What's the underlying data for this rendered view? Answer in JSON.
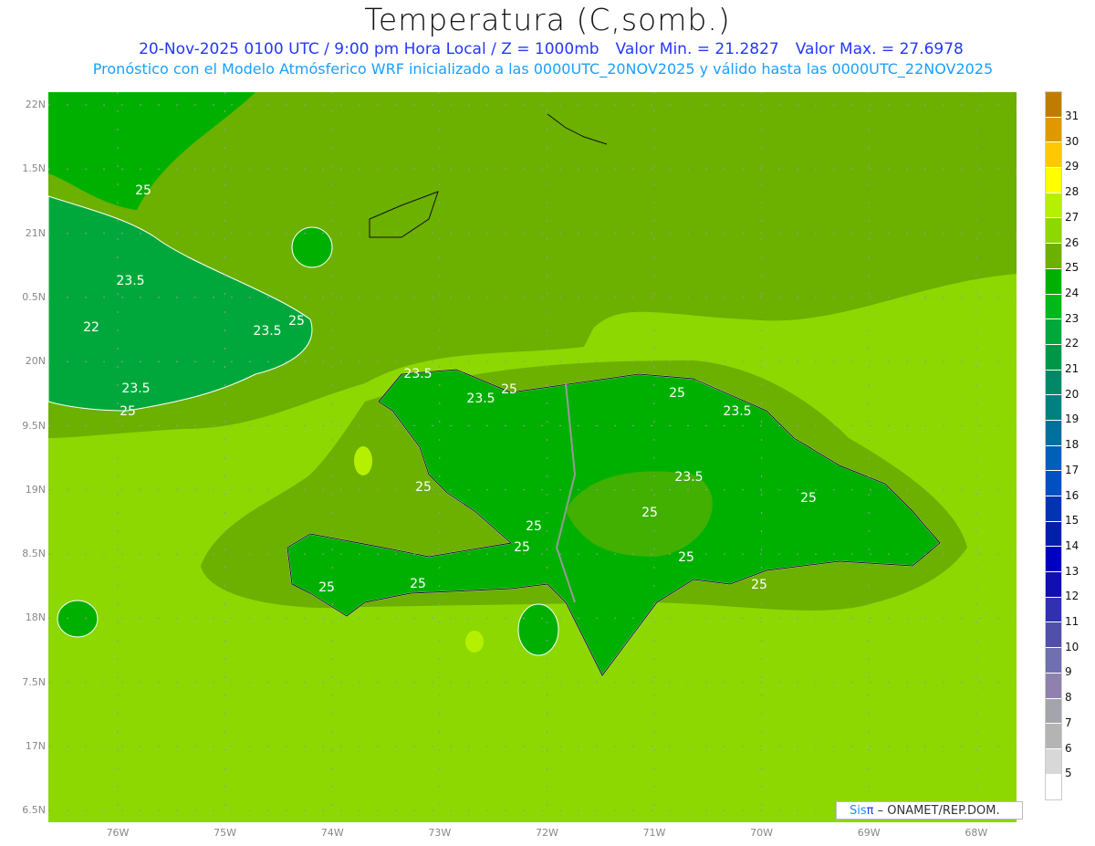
{
  "header": {
    "title": "Temperatura (C,somb.)",
    "date_line": "20-Nov-2025  0100 UTC / 9:00 pm Hora Local / Z = 1000mb",
    "min_label": "Valor Min. = 21.2827",
    "max_label": "Valor Max. = 27.6978",
    "model_line": "Pronóstico con el Modelo Atmósferico WRF inicializado a las 0000UTC_20NOV2025 y válido hasta las  0000UTC_22NOV2025"
  },
  "axes": {
    "lat_labels": [
      "22N",
      "1.5N",
      "21N",
      "0.5N",
      "20N",
      "9.5N",
      "19N",
      "8.5N",
      "18N",
      "7.5N",
      "17N",
      "6.5N"
    ],
    "lon_labels": [
      "76W",
      "75W",
      "74W",
      "73W",
      "72W",
      "71W",
      "70W",
      "69W",
      "68W"
    ]
  },
  "contour_labels": [
    "25",
    "23.5",
    "22",
    "23.5",
    "25",
    "23.5",
    "25",
    "23.5",
    "23.5",
    "25",
    "25",
    "23.5",
    "23.5",
    "25",
    "25",
    "25",
    "25",
    "25",
    "25",
    "25",
    "25",
    "25"
  ],
  "colorbar": {
    "labels": [
      "31",
      "30",
      "29",
      "28",
      "27",
      "26",
      "25",
      "24",
      "23",
      "22",
      "21",
      "20",
      "19",
      "18",
      "17",
      "16",
      "15",
      "14",
      "13",
      "12",
      "11",
      "10",
      "9",
      "8",
      "7",
      "6",
      "5"
    ],
    "colors": [
      "#c07c00",
      "#e09800",
      "#ffc800",
      "#ffff00",
      "#b4f000",
      "#8cd800",
      "#6cb000",
      "#00b000",
      "#00b81c",
      "#00a83c",
      "#009648",
      "#008868",
      "#008080",
      "#00709c",
      "#0060b8",
      "#0050c0",
      "#0034b0",
      "#0020a8",
      "#0000c0",
      "#1010b0",
      "#3030b0",
      "#5050a8",
      "#7070b0",
      "#9080b0",
      "#a4a4ac",
      "#b4b4b4",
      "#d8d8d8",
      "#ffffff"
    ]
  },
  "credit": {
    "brand": "Sis",
    "pi": "π",
    "text": " –  ONAMET/REP.DOM."
  }
}
